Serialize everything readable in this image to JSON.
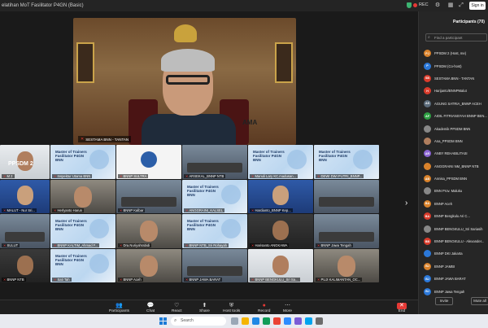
{
  "window": {
    "title": "elatihan MoT Fasilitator P4GN (Basic)",
    "rec_label": "REC",
    "signin_label": "Sign in"
  },
  "speaker": {
    "name_label": "SESTAMA BNN - TANTAN",
    "wall_text": "AMA"
  },
  "gallery": {
    "section_label": "PPSDM 2",
    "tiles": [
      {
        "name": "M 2",
        "style": "t-white"
      },
      {
        "name": "Inspektur Utama BNN",
        "style": "t-poster",
        "poster": "Master of Trainers Fasilitator P4GN BNN"
      },
      {
        "name": "BNNP SULTRA",
        "style": "t-logo"
      },
      {
        "name": "ARSEKAL_BNNP NTB",
        "style": "t-room"
      },
      {
        "name": "Manuli Lary KC.madusan...",
        "style": "t-poster",
        "poster": "Master of Trainers Fasilitator P4GN BNN"
      },
      {
        "name": "DEWI DWI PUTRI_BNNP...",
        "style": "t-poster",
        "poster": "Master of Trainers Fasilitator P4GN BNN"
      },
      {
        "name": "",
        "style": "t-stripe"
      },
      {
        "name": "MALUT - Nur Sri...",
        "style": "t-blue"
      },
      {
        "name": "Herlyanto Harun",
        "style": "t-face"
      },
      {
        "name": "BNNP Kalbar",
        "style": "t-room"
      },
      {
        "name": "ANGGRAINI_KALSEL",
        "style": "t-poster",
        "poster": "Master of Trainers Fasilitator P4GN BNN"
      },
      {
        "name": "Hardianto_BNNP Kep...",
        "style": "t-blue"
      },
      {
        "name": "",
        "style": "t-room"
      },
      {
        "name": "",
        "style": "t-stripe"
      },
      {
        "name": "SULUT",
        "style": "t-room"
      },
      {
        "name": "BNNP KALTIM_Ahmad F...",
        "style": "t-poster",
        "poster": "Master of Trainers Fasilitator P4GN BNN"
      },
      {
        "name": "Dra.Nuriyahrabidi",
        "style": "t-face"
      },
      {
        "name": "BNNP NTB_Sri Rohayah",
        "style": "t-poster",
        "poster": "Master of Trainers Fasilitator P4GN BNN"
      },
      {
        "name": "Harisanto ANGKAWA",
        "style": "t-dark"
      },
      {
        "name": "BNNP Jawa Tengah",
        "style": "t-room"
      },
      {
        "name": "",
        "style": "t-stripe"
      },
      {
        "name": "BNNP NTB",
        "style": "t-dark"
      },
      {
        "name": "Sati Tah",
        "style": "t-poster",
        "poster": "Master of Trainers Fasilitator P4GN BNN"
      },
      {
        "name": "BNNP Aceh",
        "style": "t-face"
      },
      {
        "name": "BNNP JAWA BARAT",
        "style": "t-room"
      },
      {
        "name": "BNNP BENGKULU_Sri Sa...",
        "style": "t-white"
      },
      {
        "name": "PUJI KALIMANTAN_OC...",
        "style": "t-face"
      },
      {
        "name": "",
        "style": "t-stripe"
      }
    ]
  },
  "toolbar": {
    "participants": "Participants",
    "chat": "Chat",
    "react": "React",
    "share": "Share",
    "host_tools": "Host tools",
    "record": "Record",
    "more": "More",
    "end": "End"
  },
  "participants_panel": {
    "title": "Participants (70)",
    "search_placeholder": "Find a participant",
    "invite_label": "Invite",
    "mute_all_label": "Mute all",
    "items": [
      {
        "initials": "PJ",
        "color": "#d9822b",
        "name": "PPSDM 2 (Host, me)"
      },
      {
        "initials": "P",
        "color": "#2b78d9",
        "name": "PPSDM (Co-host)"
      },
      {
        "initials": "SB",
        "color": "#d93b2b",
        "name": "SESTAMA BNN - TANTAN"
      },
      {
        "initials": "H",
        "color": "#d93b2b",
        "name": "Harijanto/BNNPMalut"
      },
      {
        "initials": "AS",
        "color": "#5b6b7b",
        "name": "AGUNG SATRIA_BNNP ACEH"
      },
      {
        "initials": "AF",
        "color": "#2ea043",
        "name": "AIDIL FITRIANSYAH BNNP BEN..."
      },
      {
        "initials": "",
        "color": "#888888",
        "name": "Akademik PPSDM BNN"
      },
      {
        "initials": "",
        "color": "#b07e5e",
        "name": "Ana_PPSDM BNN"
      },
      {
        "initials": "AR",
        "color": "#8a63d2",
        "name": "ANBY REHABILITASI"
      },
      {
        "initials": "",
        "color": "#d9822b",
        "name": "ANGGRAINI NM_BNNP NTB"
      },
      {
        "initials": "AB",
        "color": "#d9822b",
        "name": "Annisa_PPSDM BNN"
      },
      {
        "initials": "",
        "color": "#888888",
        "name": "BNN Prov. Maluku"
      },
      {
        "initials": "BA",
        "color": "#d9822b",
        "name": "BNNP Aceh"
      },
      {
        "initials": "BA",
        "color": "#d93b2b",
        "name": "BNNP Bengkulu Ari C..."
      },
      {
        "initials": "",
        "color": "#888888",
        "name": "BNNP BENGKULU_Sri Sariasih"
      },
      {
        "initials": "BB",
        "color": "#d93b2b",
        "name": "BNNP BENGKULU - Alexander..."
      },
      {
        "initials": "",
        "color": "#2b78d9",
        "name": "BNNP DKI Jakarta"
      },
      {
        "initials": "BJ",
        "color": "#d9822b",
        "name": "BNNP JAMBI"
      },
      {
        "initials": "BJ",
        "color": "#2b78d9",
        "name": "BNNP JAWA BARAT"
      },
      {
        "initials": "BJ",
        "color": "#2b78d9",
        "name": "BNNP Jawa Tengah"
      }
    ]
  },
  "taskbar": {
    "search_label": "Search"
  }
}
